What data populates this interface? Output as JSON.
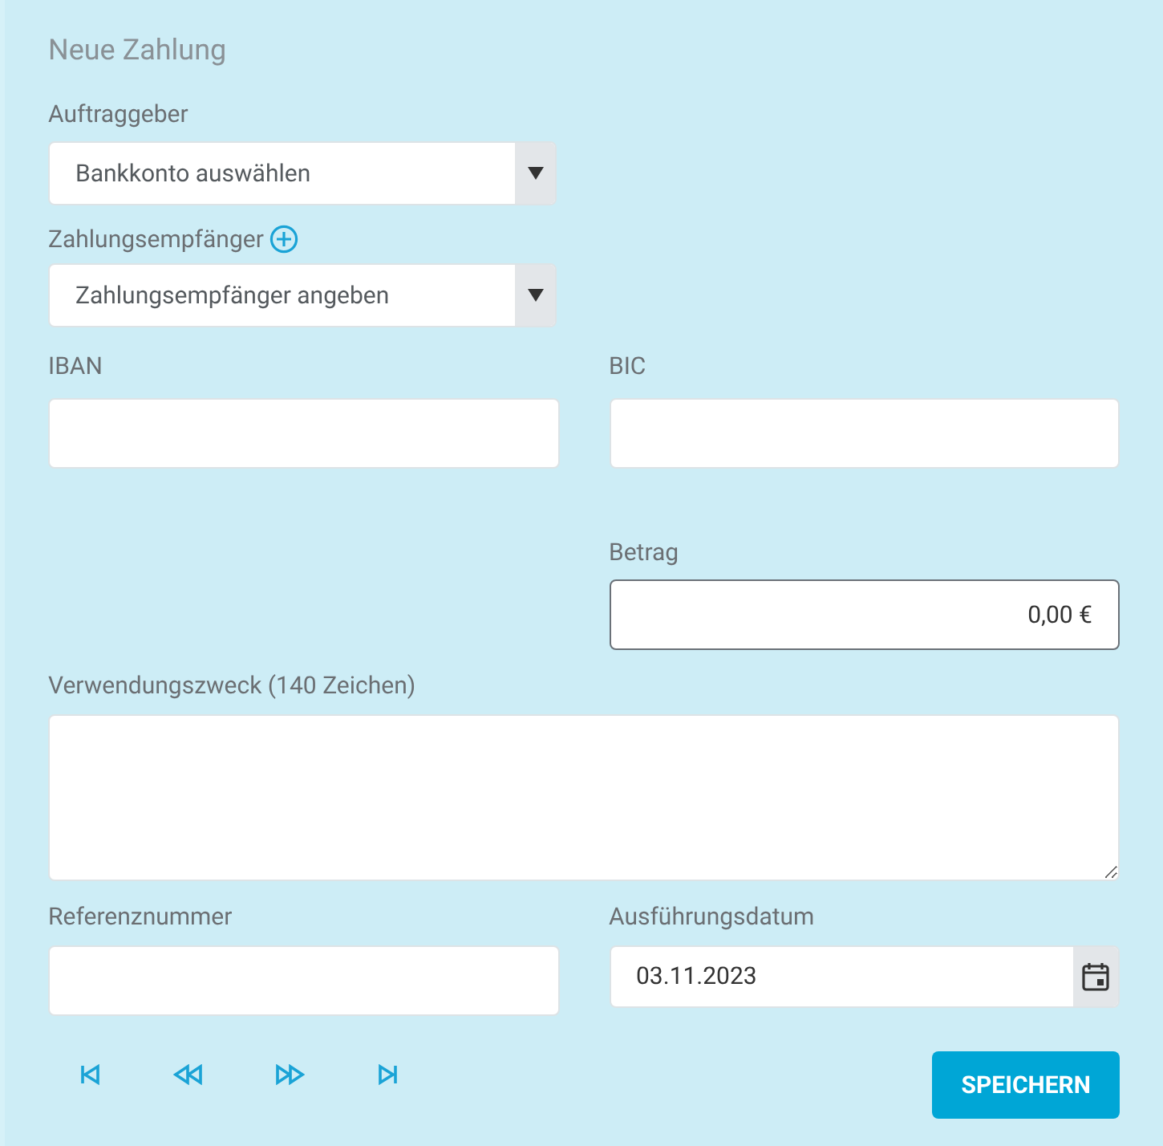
{
  "title": "Neue Zahlung",
  "auftraggeber": {
    "label": "Auftraggeber",
    "value": "Bankkonto auswählen"
  },
  "empfaenger": {
    "label": "Zahlungsempfänger",
    "value": "Zahlungsempfänger angeben"
  },
  "iban": {
    "label": "IBAN"
  },
  "bic": {
    "label": "BIC"
  },
  "betrag": {
    "label": "Betrag",
    "value": "0,00 €",
    "focused": true
  },
  "verwendungszweck": {
    "label": "Verwendungszweck (140 Zeichen)"
  },
  "referenz": {
    "label": "Referenznummer"
  },
  "datum": {
    "label": "Ausführungsdatum",
    "value": "03.11.2023"
  },
  "nav_buttons": [
    {
      "kind": "first"
    },
    {
      "kind": "prev"
    },
    {
      "kind": "next"
    },
    {
      "kind": "last"
    }
  ],
  "save_button": "SPEICHERN"
}
